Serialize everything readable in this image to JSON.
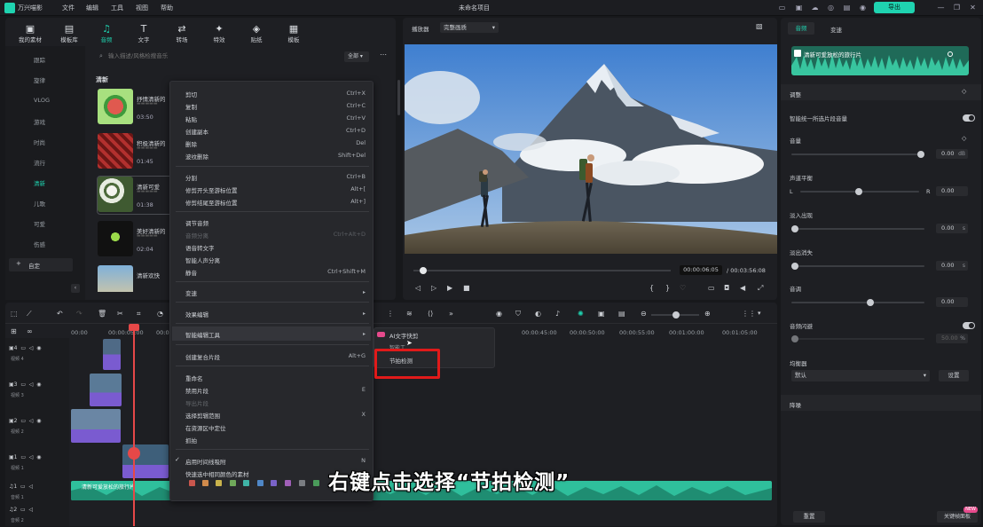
{
  "app": {
    "name": "万兴喵影",
    "title": "未命名项目",
    "export_label": "导出"
  },
  "menubar": [
    "文件",
    "编辑",
    "工具",
    "视图",
    "帮助"
  ],
  "toolbar": [
    {
      "label": "我的素材",
      "icon": "folder-icon"
    },
    {
      "label": "模板库",
      "icon": "template-icon"
    },
    {
      "label": "音频",
      "icon": "music-note-icon"
    },
    {
      "label": "文字",
      "icon": "text-icon"
    },
    {
      "label": "转场",
      "icon": "transition-icon"
    },
    {
      "label": "特效",
      "icon": "effects-icon"
    },
    {
      "label": "贴纸",
      "icon": "sticker-icon"
    },
    {
      "label": "模板",
      "icon": "layout-template-icon"
    }
  ],
  "library": {
    "search_placeholder": "输入描述/风格检搜音乐",
    "filter": "全部",
    "categories": [
      "跟踪",
      "旋律",
      "VLOG",
      "游戏",
      "时尚",
      "流行",
      "清新",
      "儿歌",
      "可爱",
      "伤感",
      "自定"
    ],
    "active_category": "清新",
    "section_title": "清新",
    "tracks": [
      {
        "title": "抒情清新的",
        "duration": "03:50"
      },
      {
        "title": "积极清新的",
        "duration": "01:45"
      },
      {
        "title": "清新可爱",
        "duration": "01:38"
      },
      {
        "title": "美好清新的",
        "duration": "02:04"
      },
      {
        "title": "清新欢快",
        "duration": ""
      }
    ]
  },
  "context_menu": {
    "groups": [
      [
        {
          "label": "剪切",
          "shortcut": "Ctrl+X"
        },
        {
          "label": "复制",
          "shortcut": "Ctrl+C"
        },
        {
          "label": "粘贴",
          "shortcut": "Ctrl+V"
        },
        {
          "label": "创建副本",
          "shortcut": "Ctrl+D"
        },
        {
          "label": "删除",
          "shortcut": "Del"
        },
        {
          "label": "波纹删除",
          "shortcut": "Shift+Del"
        }
      ],
      [
        {
          "label": "分割",
          "shortcut": "Ctrl+B"
        },
        {
          "label": "修剪开头至游标位置",
          "shortcut": "Alt+["
        },
        {
          "label": "修剪结尾至游标位置",
          "shortcut": "Alt+]"
        }
      ],
      [
        {
          "label": "调节音频",
          "shortcut": ""
        },
        {
          "label": "音频分离",
          "shortcut": "Ctrl+Alt+D",
          "disabled": true
        },
        {
          "label": "语音转文字",
          "shortcut": ""
        },
        {
          "label": "智能人声分离",
          "shortcut": ""
        },
        {
          "label": "静音",
          "shortcut": "Ctrl+Shift+M"
        }
      ],
      [
        {
          "label": "变速",
          "submenu": true
        }
      ],
      [
        {
          "label": "效果编辑",
          "submenu": true
        }
      ],
      [
        {
          "label": "智能编辑工具",
          "submenu": true
        }
      ],
      [
        {
          "label": "创建复合片段",
          "shortcut": "Alt+G"
        }
      ],
      [
        {
          "label": "重命名",
          "shortcut": ""
        },
        {
          "label": "禁用片段",
          "shortcut": "E"
        },
        {
          "label": "导出片段",
          "shortcut": "",
          "disabled": true
        },
        {
          "label": "选择剪辑范围",
          "shortcut": "X"
        },
        {
          "label": "在资源区中定位",
          "shortcut": ""
        },
        {
          "label": "抓拍",
          "shortcut": ""
        }
      ],
      [
        {
          "label": "启用时间线吸附",
          "shortcut": "N",
          "checked": true
        },
        {
          "label": "快速选中相同颜色的素材",
          "shortcut": ""
        }
      ]
    ],
    "swatch_colors": [
      "#c9564d",
      "#d08a4b",
      "#c9b34c",
      "#6fa85a",
      "#3fb3a6",
      "#4f87c7",
      "#7a63c9",
      "#a05fb8",
      "#7a7d82",
      "#4a9b5a"
    ]
  },
  "submenu": {
    "items": [
      {
        "label": "AI文字快剪",
        "badge": "new"
      },
      {
        "label": "智能工",
        "disabled": false
      },
      {
        "label": "节拍检测"
      }
    ]
  },
  "viewer": {
    "player_label": "播放器",
    "quality": "完整画质",
    "current_time": "00:00:06:05",
    "total_time": "/ 00:03:56:08"
  },
  "right_panel": {
    "tabs": [
      "音频",
      "变速"
    ],
    "active_tab": "音频",
    "audio_clip_name": "清新可爱放松的旅行片",
    "section_adjust": "调整",
    "auto_normalize": "智能统一所选片段音量",
    "volume": {
      "label": "音量",
      "value": "0.00",
      "unit": "dB"
    },
    "balance": {
      "label": "声道平衡",
      "left": "L",
      "right": "R",
      "value": "0.00"
    },
    "fade_in": {
      "label": "淡入出现",
      "value": "0.00",
      "unit": "s"
    },
    "fade_out": {
      "label": "淡出消失",
      "value": "0.00",
      "unit": "s"
    },
    "pitch": {
      "label": "音调",
      "value": "0.00"
    },
    "ducking": {
      "label": "音频闪避",
      "value": "50.00",
      "unit": "%"
    },
    "equalizer": {
      "label": "均衡器",
      "preset": "默认",
      "settings_label": "设置"
    },
    "section_denoise": "降噪",
    "reset_label": "重置",
    "keyframe_label": "关键帧面板",
    "keyframe_badge": "NEW"
  },
  "timeline": {
    "ruler": [
      "00:00",
      "00:00:05:00",
      "00:00:10:00",
      "00:00:45:00",
      "00:00:50:00",
      "00:00:55:00",
      "00:01:00:00",
      "00:01:05:00"
    ],
    "tracks": [
      {
        "num": "4",
        "name": "视频 4"
      },
      {
        "num": "3",
        "name": "视频 3"
      },
      {
        "num": "2",
        "name": "视频 2"
      },
      {
        "num": "1",
        "name": "视频 1"
      },
      {
        "num": "1",
        "name": "音频 1"
      },
      {
        "num": "2",
        "name": "音频 2"
      }
    ],
    "audio_clip_label": "清新可爱放松的旅行片"
  },
  "subtitle": "右键点击选择“节拍检测”",
  "colors": {
    "accent": "#1fd3b0",
    "highlight_box": "#e01a1a",
    "audio_clip": "#2fbf9c",
    "video_clip": "#7a5bd0"
  }
}
